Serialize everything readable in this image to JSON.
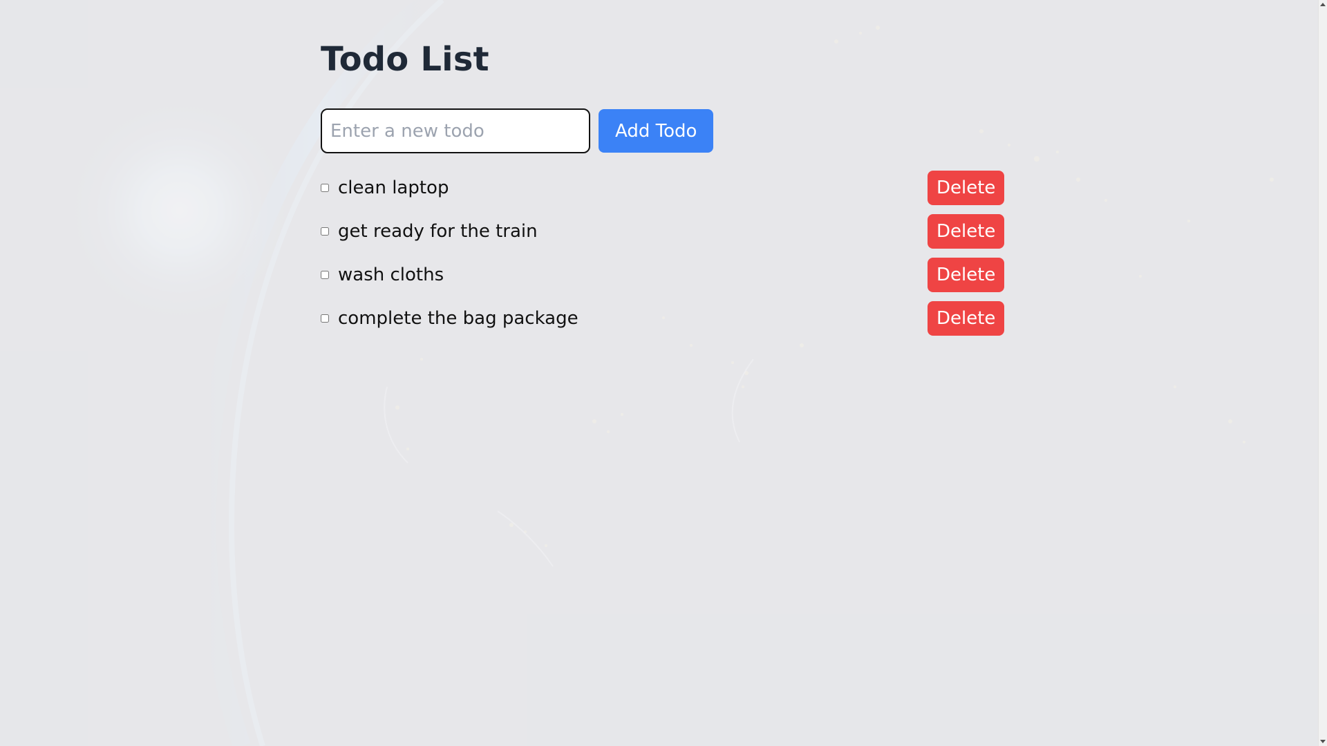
{
  "page": {
    "title": "Todo List"
  },
  "add_form": {
    "input_value": "",
    "input_placeholder": "Enter a new todo",
    "add_button_label": "Add Todo"
  },
  "todos": [
    {
      "text": "clean laptop",
      "checked": false,
      "delete_label": "Delete"
    },
    {
      "text": "get ready for the train",
      "checked": false,
      "delete_label": "Delete"
    },
    {
      "text": "wash cloths",
      "checked": false,
      "delete_label": "Delete"
    },
    {
      "text": "complete the bag package",
      "checked": false,
      "delete_label": "Delete"
    }
  ],
  "colors": {
    "page_background": "#e6e7e9",
    "title": "#1f2937",
    "add_button": "#3b82f6",
    "delete_button": "#ef4444"
  },
  "icons": {
    "scroll_up": "triangle-up-icon",
    "scroll_down": "triangle-down-icon"
  }
}
